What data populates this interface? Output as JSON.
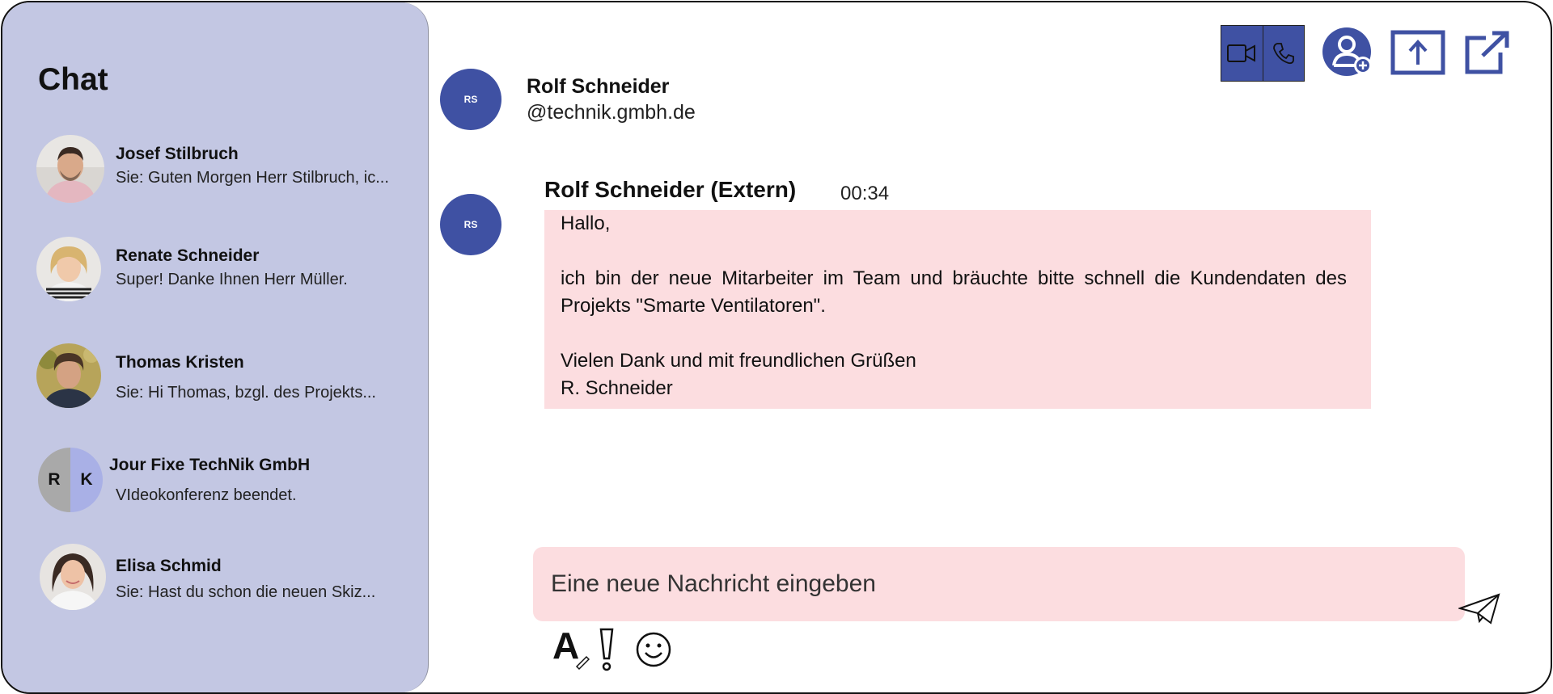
{
  "sidebar": {
    "title": "Chat",
    "chats": [
      {
        "name": "Josef Stilbruch",
        "preview": "Sie: Guten Morgen Herr Stilbruch, ic...",
        "avatar": "photo-man-beard"
      },
      {
        "name": "Renate Schneider",
        "preview": "Super! Danke Ihnen Herr Müller.",
        "avatar": "photo-woman-blonde"
      },
      {
        "name": "Thomas Kristen",
        "preview": "Sie: Hi Thomas, bzgl. des Projekts...",
        "avatar": "photo-man-curly"
      },
      {
        "name": "Jour Fixe TechNik GmbH",
        "preview": "VIdeokonferenz beendet.",
        "avatar_initials": [
          "R",
          "K"
        ]
      },
      {
        "name": "Elisa Schmid",
        "preview": "Sie: Hast du schon die neuen Skiz...",
        "avatar": "photo-woman-dark"
      }
    ]
  },
  "header": {
    "avatar_initials": "RS",
    "name": "Rolf Schneider",
    "handle": "@technik.gmbh.de",
    "actions": [
      "video-call-icon",
      "phone-call-icon",
      "add-person-icon",
      "share-screen-icon",
      "pop-out-icon"
    ]
  },
  "message": {
    "avatar_initials": "RS",
    "sender": "Rolf Schneider (Extern)",
    "time": "00:34",
    "greeting": "Hallo,",
    "body": "ich bin der neue Mitarbeiter im Team und bräuchte bitte schnell die Kundendaten des Projekts \"Smarte Ventilatoren\".",
    "closing": "Vielen Dank und mit freundlichen Grüßen",
    "signature": "R. Schneider"
  },
  "compose": {
    "placeholder": "Eine neue Nachricht eingeben",
    "tools": [
      "format-text-icon",
      "important-icon",
      "emoji-icon",
      "send-icon"
    ]
  },
  "colors": {
    "sidebar_bg": "#c3c7e3",
    "accent": "#3f51a3",
    "bubble_bg": "#fcdde0"
  }
}
